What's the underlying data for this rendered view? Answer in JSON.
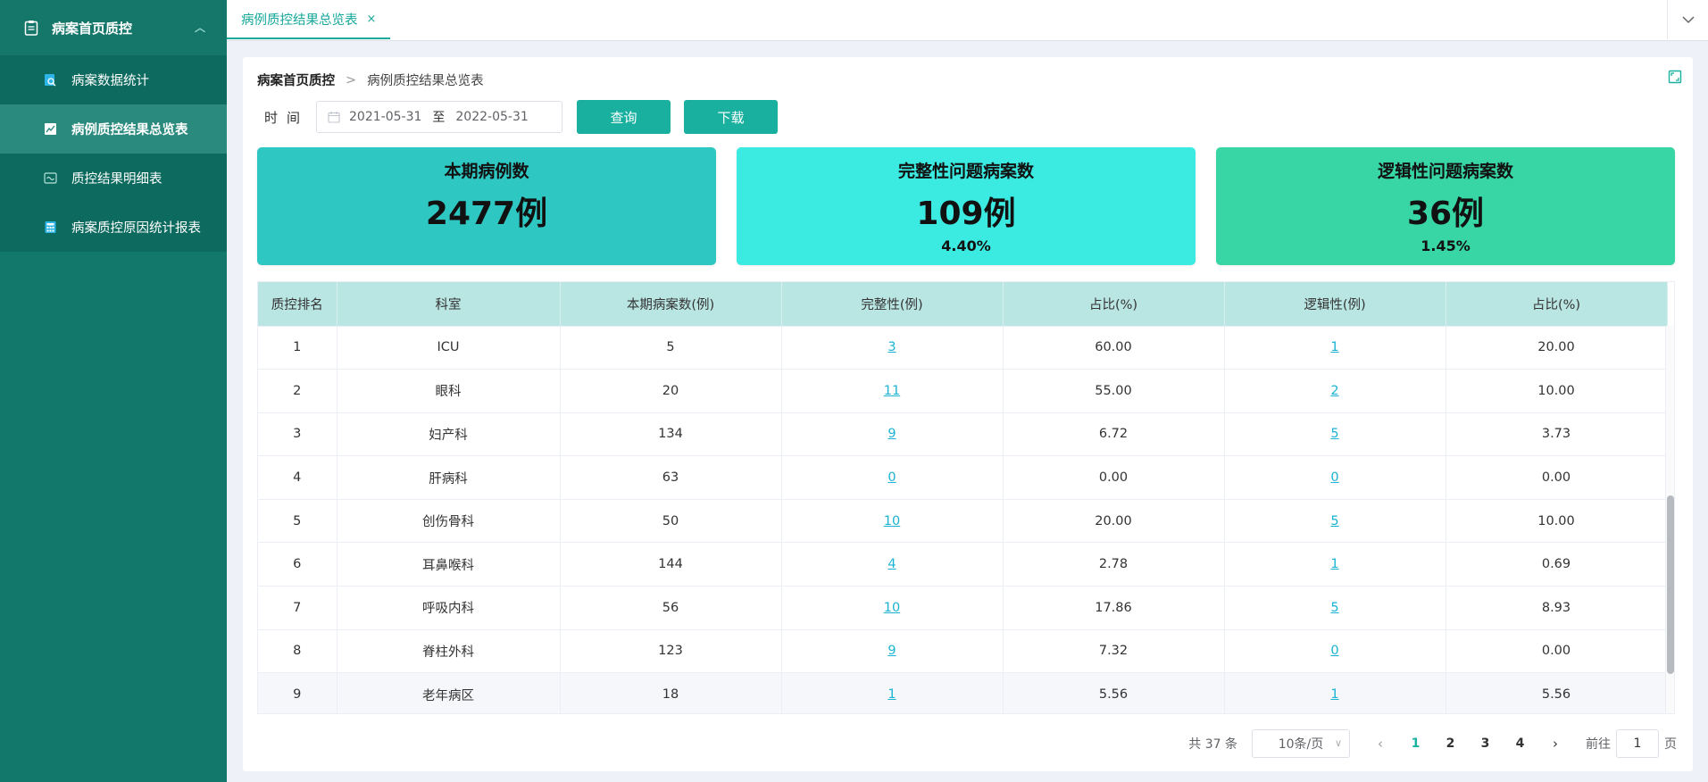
{
  "sidebar": {
    "header": "病案首页质控",
    "items": [
      {
        "label": "病案数据统计",
        "active": false
      },
      {
        "label": "病例质控结果总览表",
        "active": true
      },
      {
        "label": "质控结果明细表",
        "active": false
      },
      {
        "label": "病案质控原因统计报表",
        "active": false
      }
    ]
  },
  "tabs": [
    {
      "label": "病例质控结果总览表",
      "close": "×"
    }
  ],
  "breadcrumb": {
    "parent": "病案首页质控",
    "separator": ">",
    "current": "病例质控结果总览表"
  },
  "filter": {
    "label": "时间",
    "start_date": "2021-05-31",
    "to": "至",
    "end_date": "2022-05-31",
    "query_button": "查询",
    "download_button": "下载"
  },
  "stats": [
    {
      "title": "本期病例数",
      "value": "2477例",
      "percent": "",
      "color": "#2fc7c2"
    },
    {
      "title": "完整性问题病案数",
      "value": "109例",
      "percent": "4.40%",
      "color": "#3beae0"
    },
    {
      "title": "逻辑性问题病案数",
      "value": "36例",
      "percent": "1.45%",
      "color": "#38d6a4"
    }
  ],
  "table": {
    "headers": [
      "质控排名",
      "科室",
      "本期病案数(例)",
      "完整性(例)",
      "占比(%)",
      "逻辑性(例)",
      "占比(%)"
    ],
    "rows": [
      [
        "1",
        "ICU",
        "5",
        "3",
        "60.00",
        "1",
        "20.00"
      ],
      [
        "2",
        "眼科",
        "20",
        "11",
        "55.00",
        "2",
        "10.00"
      ],
      [
        "3",
        "妇产科",
        "134",
        "9",
        "6.72",
        "5",
        "3.73"
      ],
      [
        "4",
        "肝病科",
        "63",
        "0",
        "0.00",
        "0",
        "0.00"
      ],
      [
        "5",
        "创伤骨科",
        "50",
        "10",
        "20.00",
        "5",
        "10.00"
      ],
      [
        "6",
        "耳鼻喉科",
        "144",
        "4",
        "2.78",
        "1",
        "0.69"
      ],
      [
        "7",
        "呼吸内科",
        "56",
        "10",
        "17.86",
        "5",
        "8.93"
      ],
      [
        "8",
        "脊柱外科",
        "123",
        "9",
        "7.32",
        "0",
        "0.00"
      ],
      [
        "9",
        "老年病区",
        "18",
        "1",
        "5.56",
        "1",
        "5.56"
      ]
    ]
  },
  "pagination": {
    "total": "共 37 条",
    "page_size": "10条/页",
    "pages": [
      "1",
      "2",
      "3",
      "4"
    ],
    "current": "1",
    "goto_label": "前往",
    "goto_value": "1",
    "page_unit": "页"
  }
}
